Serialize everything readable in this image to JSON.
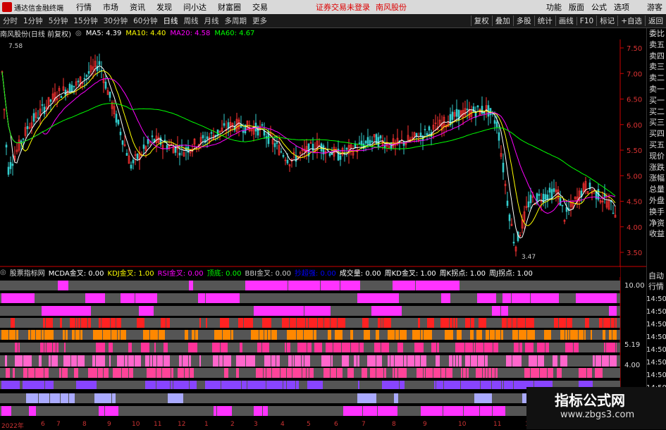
{
  "topbar": {
    "app_title": "通达信金融终端",
    "menus": [
      "行情",
      "市场",
      "资讯",
      "发现",
      "问小达",
      "财富圈",
      "交易"
    ],
    "notice": "证券交易未登录",
    "stock_name": "南风股份",
    "right_menus": [
      "功能",
      "版面",
      "公式",
      "选项",
      "游客"
    ]
  },
  "toolbar": {
    "periods": [
      "分时",
      "1分钟",
      "5分钟",
      "15分钟",
      "30分钟",
      "60分钟",
      "日线",
      "周线",
      "月线",
      "多周期",
      "更多"
    ],
    "active_period": "日线",
    "right_buttons": [
      "复权",
      "叠加",
      "多股",
      "统计",
      "画线",
      "F10",
      "标记",
      "+自选",
      "返回"
    ]
  },
  "infobar": {
    "title": "南风股份(日线 前复权)",
    "ma5": "MA5: 4.39",
    "ma10": "MA10: 4.40",
    "ma20": "MA20: 4.58",
    "ma60": "MA60: 4.67",
    "high_label": "7.58",
    "low_label": "3.47",
    "colors": {
      "ma5": "#ffffff",
      "ma10": "#ffff00",
      "ma20": "#ff00ff",
      "ma60": "#00ff00"
    }
  },
  "y_ticks": [
    "7.50",
    "7.00",
    "6.50",
    "6.00",
    "5.50",
    "5.00",
    "4.50",
    "4.00",
    "3.50"
  ],
  "indicator_bar": {
    "name": "股票指标网",
    "items": [
      {
        "label": "MCDA金叉: 0.00",
        "color": "#ffffff"
      },
      {
        "label": "KDJ金叉: 1.00",
        "color": "#ffff00"
      },
      {
        "label": "RSI金叉: 0.00",
        "color": "#ff00ff"
      },
      {
        "label": "顶底: 0.00",
        "color": "#00ff00"
      },
      {
        "label": "BBI金叉: 0.00",
        "color": "#cccccc"
      },
      {
        "label": "抄超强: 0.00",
        "color": "#0000ff"
      },
      {
        "label": "成交量: 0.00",
        "color": "#ffffff"
      },
      {
        "label": "周KD金叉: 1.00",
        "color": "#ffffff"
      },
      {
        "label": "周K拐点: 1.00",
        "color": "#ffffff"
      },
      {
        "label": "周J拐点: 1.00",
        "color": "#ffffff"
      }
    ]
  },
  "lower_axis": {
    "top_value": "10.00",
    "mid_value": "5.19",
    "low_value": "4.00"
  },
  "right_panel": {
    "labels": [
      "委比",
      "卖五",
      "卖四",
      "卖三",
      "卖二",
      "卖一",
      "买一",
      "买二",
      "买三",
      "买四",
      "买五",
      "现价",
      "涨跌",
      "涨幅",
      "总量",
      "外盘",
      "换手",
      "净资",
      "收益"
    ],
    "labels2": [
      "自动",
      "行情"
    ],
    "times": [
      "14:50",
      "14:50",
      "14:50",
      "14:50",
      "14:50",
      "14:50",
      "14:50",
      "14:50",
      "14:50"
    ]
  },
  "x_axis": [
    "2022年",
    "6",
    "7",
    "8",
    "9",
    "10",
    "11",
    "12",
    "1",
    "2",
    "3",
    "4",
    "5",
    "6",
    "7",
    "8",
    "9",
    "10",
    "11",
    "12"
  ],
  "watermark": {
    "title": "指标公式网",
    "url": "www.zbgs3.com"
  }
}
